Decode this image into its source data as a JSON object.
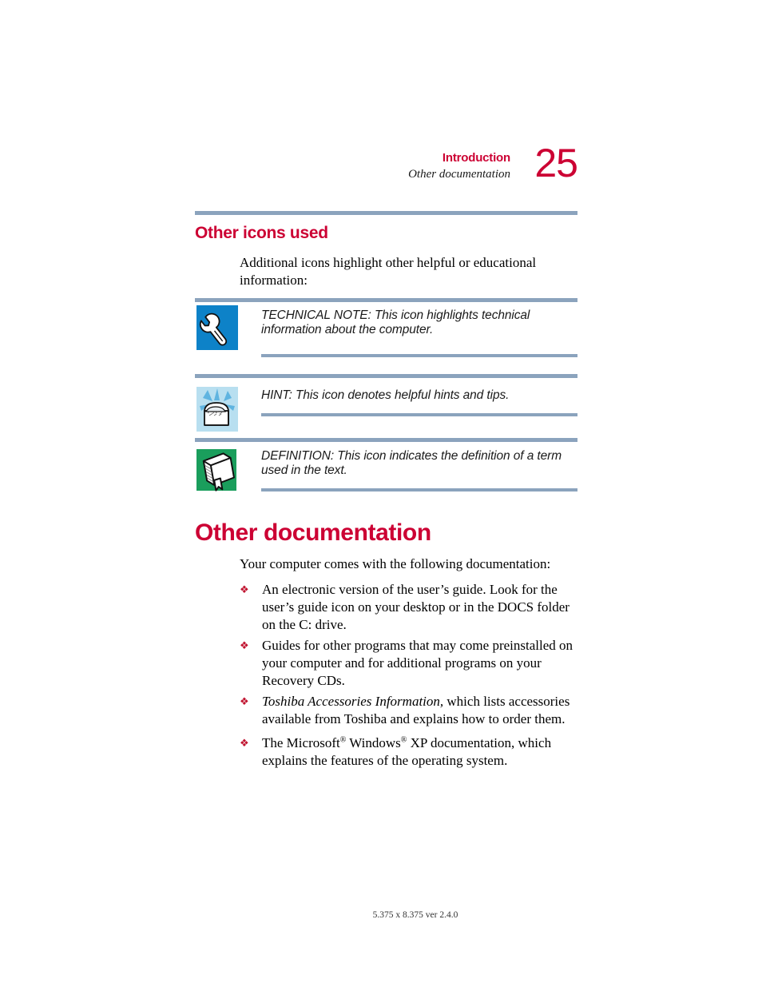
{
  "header": {
    "chapter": "Introduction",
    "section": "Other documentation",
    "page_number": "25"
  },
  "section_icons": {
    "heading": "Other icons used",
    "intro": "Additional icons highlight other helpful or educational information:",
    "notes": [
      {
        "icon": "wrench-icon",
        "label": "TECHNICAL NOTE:",
        "text": "TECHNICAL NOTE: This icon highlights technical information about the computer."
      },
      {
        "icon": "treasure-chest-icon",
        "label": "HINT:",
        "text": "HINT: This icon denotes helpful hints and tips."
      },
      {
        "icon": "book-icon",
        "label": "DEFINITION:",
        "text": "DEFINITION: This icon indicates the definition of a term used in the text."
      }
    ]
  },
  "section_docs": {
    "heading": "Other documentation",
    "intro": "Your computer comes with the following documentation:",
    "bullet_glyph": "❖",
    "bullets": [
      {
        "id": "electronic-users-guide",
        "text": "An electronic version of the user’s guide. Look for the user’s guide icon on your desktop or in the DOCS folder on the C: drive."
      },
      {
        "id": "guides-other-programs",
        "text": "Guides for other programs that may come preinstalled on your computer and for additional programs on your Recovery CDs."
      },
      {
        "id": "toshiba-accessories-information",
        "italic_lead": "Toshiba Accessories Information,",
        "text": "which lists accessories available from Toshiba and explains how to order them."
      },
      {
        "id": "windows-xp-documentation",
        "part1": "The Microsoft",
        "sup1": "®",
        "part2": " Windows",
        "sup2": "®",
        "part3": " XP documentation, which explains the features of the operating system."
      }
    ]
  },
  "footer": {
    "text": "5.375 x 8.375 ver 2.4.0"
  },
  "colors": {
    "accent_red": "#cc0033",
    "rule_blue": "#8ba3bd",
    "icon_blue": "#0d82c8",
    "icon_lightblue": "#b8dff0",
    "icon_green": "#1a9e5c",
    "bullet_red": "#c0132f"
  }
}
